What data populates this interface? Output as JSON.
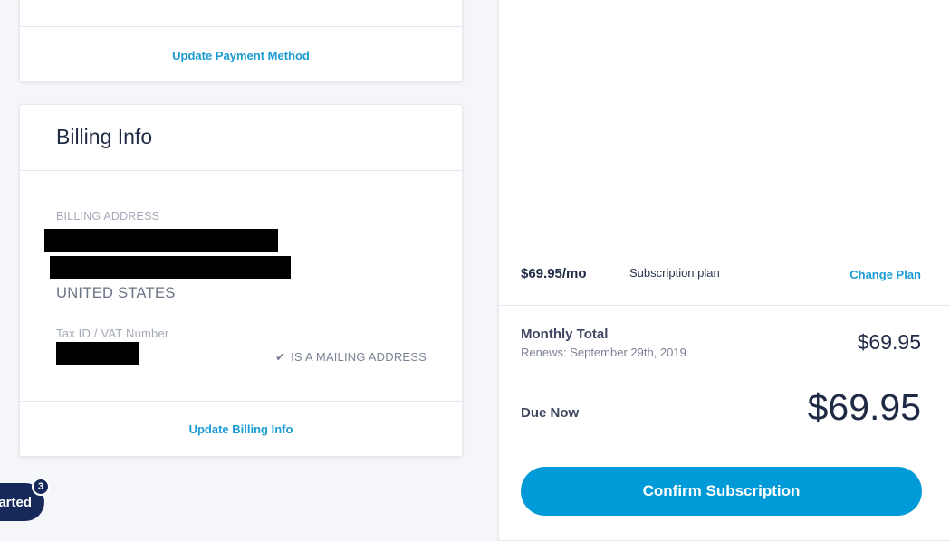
{
  "payment": {
    "update_label": "Update Payment Method"
  },
  "billing": {
    "title": "Billing Info",
    "address_label": "BILLING ADDRESS",
    "country": "UNITED STATES",
    "taxid_label": "Tax ID / VAT Number",
    "mailing_label": "IS A MAILING ADDRESS",
    "update_label": "Update Billing Info"
  },
  "summary": {
    "price_per_month": "$69.95/mo",
    "plan_label": "Subscription plan",
    "change_plan_label": "Change Plan",
    "monthly_total_label": "Monthly Total",
    "renews_text": "Renews: September 29th, 2019",
    "monthly_amount": "$69.95",
    "due_label": "Due Now",
    "due_amount": "$69.95",
    "confirm_label": "Confirm Subscription"
  },
  "launcher": {
    "label": "Get Started",
    "badge_count": "3"
  }
}
